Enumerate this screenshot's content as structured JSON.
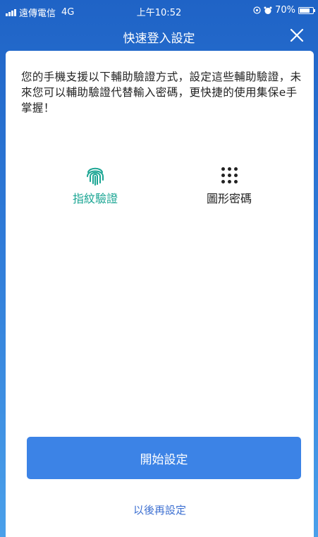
{
  "status_bar": {
    "carrier": "遠傳電信",
    "network": "4G",
    "time": "上午10:52",
    "battery": "70%"
  },
  "header": {
    "title": "快速登入設定"
  },
  "content": {
    "intro": "您的手機支援以下輔助驗證方式，設定這些輔助驗證，未來您可以輔助驗證代替輸入密碼，更快捷的使用集保e手掌握！"
  },
  "methods": [
    {
      "label": "指紋驗證",
      "icon": "fingerprint-icon",
      "color": "#1aa593"
    },
    {
      "label": "圖形密碼",
      "icon": "pattern-grid-icon",
      "color": "#222222"
    }
  ],
  "actions": {
    "start_label": "開始設定",
    "later_label": "以後再設定"
  },
  "colors": {
    "header_bg": "#1f63c6",
    "primary_button": "#3c83e6",
    "link": "#3c6fd1"
  }
}
